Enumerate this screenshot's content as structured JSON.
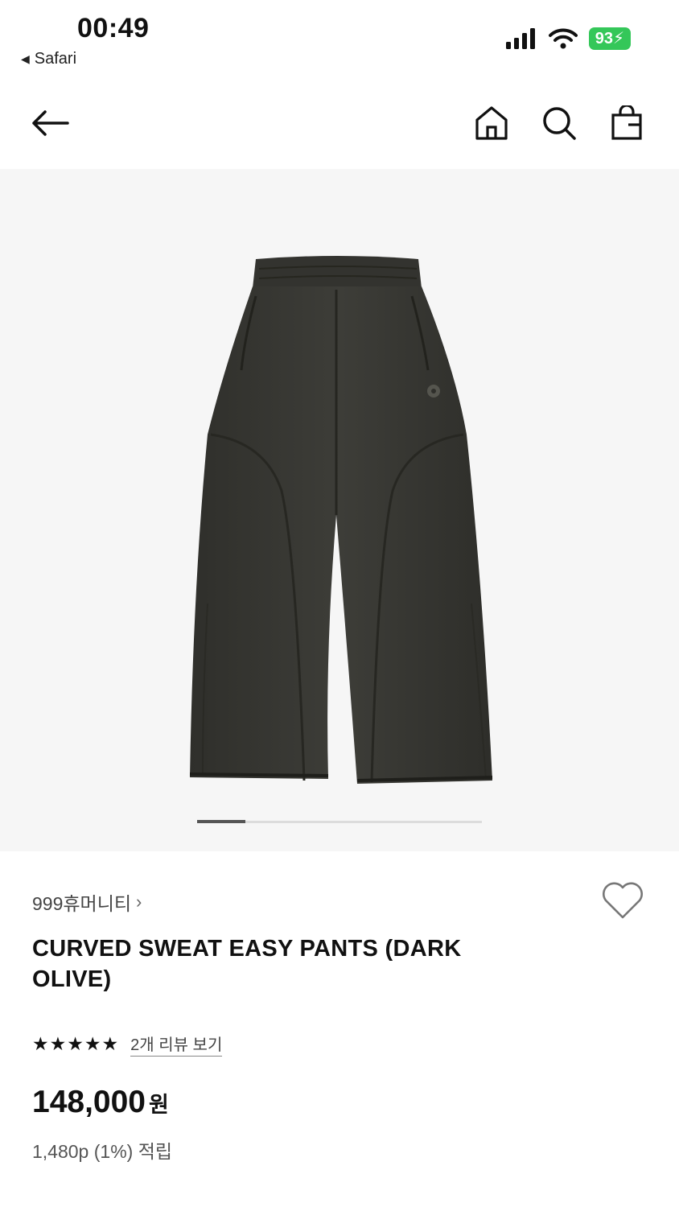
{
  "status_bar": {
    "time": "00:49",
    "back_app": "Safari",
    "battery": "93"
  },
  "icons": {
    "back": "arrow-left-icon",
    "home": "home-icon",
    "search": "search-icon",
    "cart": "shopping-bag-icon",
    "wishlist": "heart-outline-icon",
    "signal": "cellular-signal-icon",
    "wifi": "wifi-icon"
  },
  "gallery": {
    "progress": 0.17
  },
  "product": {
    "brand": "999휴머니티",
    "brand_chevron": "›",
    "title": "CURVED SWEAT EASY PANTS (DARK OLIVE)",
    "stars": "★★★★★",
    "rating": 5,
    "review_link": "2개 리뷰 보기",
    "price": "148,000",
    "currency": "원",
    "points": "1,480p (1%) 적립"
  },
  "colors": {
    "battery": "#34c759",
    "garment": "#3a3a35",
    "background": "#f6f6f6"
  }
}
